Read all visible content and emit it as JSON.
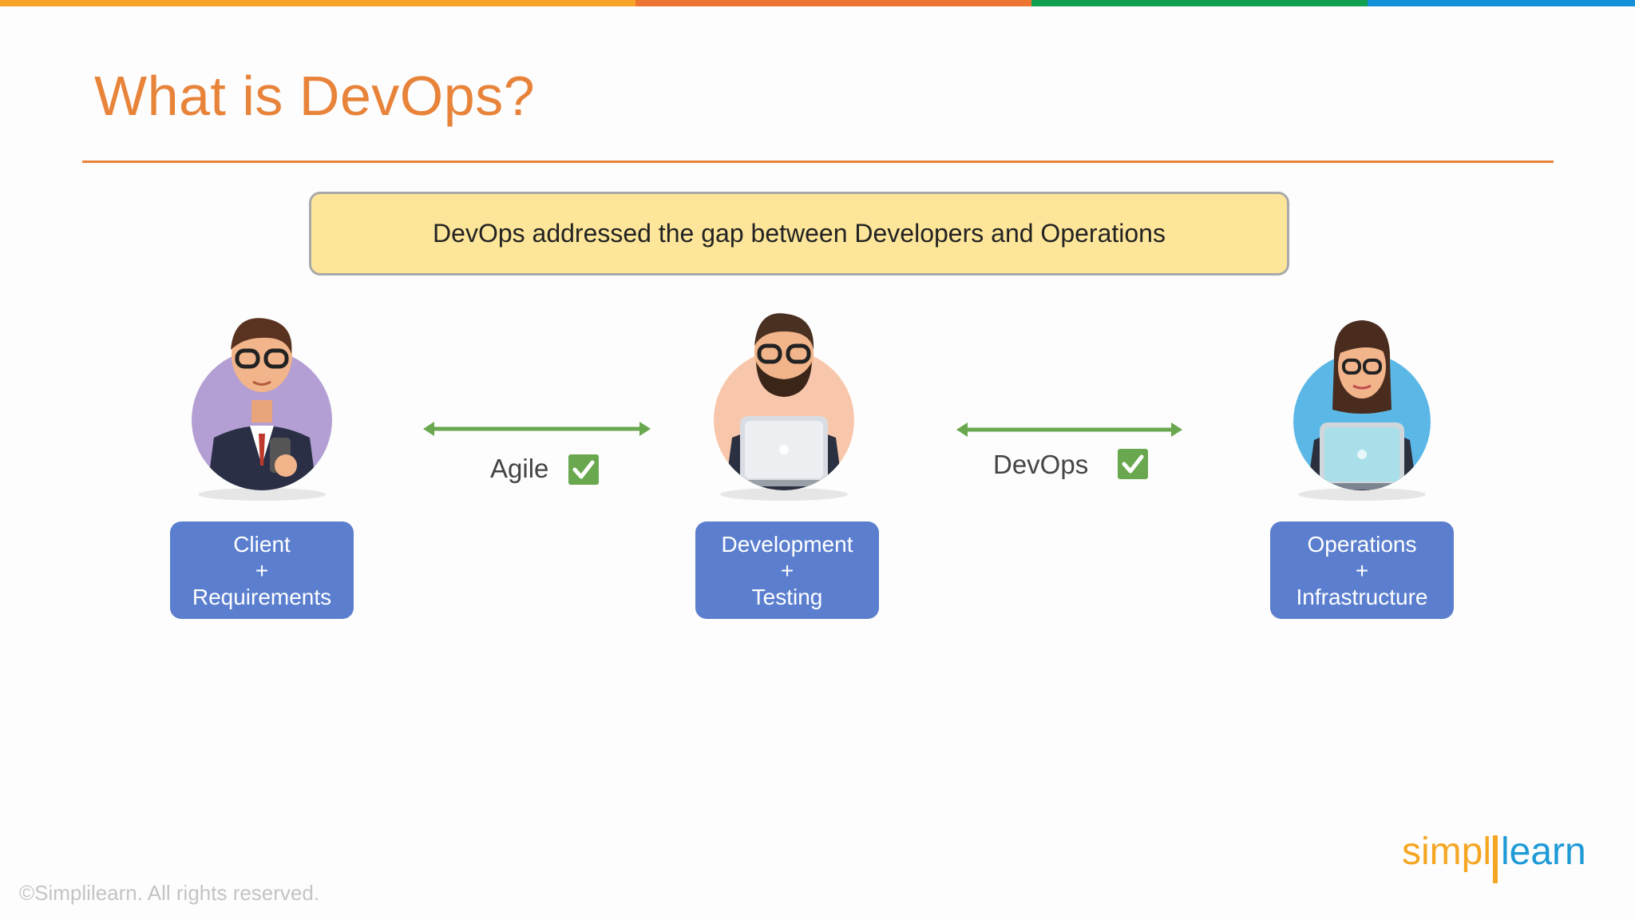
{
  "slide": {
    "title": "What is DevOps?",
    "banner": "DevOps addressed the gap between Developers and Operations",
    "colors": {
      "title": "#e8833a",
      "banner_bg": "#fde69a",
      "role_box": "#5b7fce",
      "arrow": "#6aa84f",
      "check": "#6aa84f",
      "topbar": [
        "#f7a42a",
        "#ee7531",
        "#10a050",
        "#1490d6"
      ]
    }
  },
  "roles": [
    {
      "line1": "Client",
      "line2": "+",
      "line3": "Requirements",
      "avatar_icon": "businessman-avatar-icon"
    },
    {
      "line1": "Development",
      "line2": "+",
      "line3": "Testing",
      "avatar_icon": "developer-avatar-icon"
    },
    {
      "line1": "Operations",
      "line2": "+",
      "line3": "Infrastructure",
      "avatar_icon": "operations-avatar-icon"
    }
  ],
  "links": [
    {
      "label": "Agile",
      "icon": "checkmark-icon"
    },
    {
      "label": "DevOps",
      "icon": "checkmark-icon"
    }
  ],
  "footer": {
    "copyright": "©Simplilearn. All rights reserved.",
    "logo_text_left": "simpl",
    "logo_text_right": "learn"
  }
}
